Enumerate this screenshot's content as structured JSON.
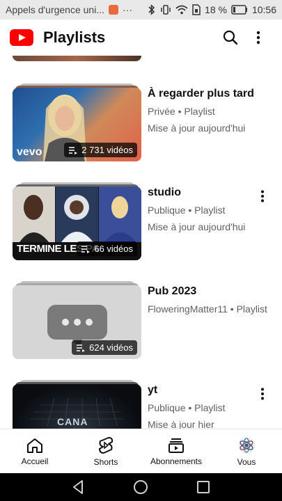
{
  "status_bar": {
    "notification": "Appels d'urgence uni...",
    "more": "···",
    "battery": "18 %",
    "time": "10:56"
  },
  "header": {
    "title": "Playlists",
    "search_icon": "search-icon",
    "more_icon": "more-vert-icon"
  },
  "playlists": [
    {
      "name": "À regarder plus tard",
      "line1": "Privée • Playlist",
      "line2": "Mise à jour aujourd'hui",
      "count": "2 731 vidéos",
      "watermark": "vevo"
    },
    {
      "name": "studio",
      "line1": "Publique • Playlist",
      "line2": "Mise à jour aujourd'hui",
      "count": "66 vidéos",
      "thumb_text": "TERMINE LES PA"
    },
    {
      "name": "Pub 2023",
      "line1": "FloweringMatter11 • Playlist",
      "line2": "",
      "count": "624 vidéos"
    },
    {
      "name": "yt",
      "line1": "Publique • Playlist",
      "line2": "Mise à jour hier",
      "thumb_text": "CANA"
    }
  ],
  "bottom_nav": {
    "home": "Accueil",
    "shorts": "Shorts",
    "subscriptions": "Abonnements",
    "you": "Vous"
  },
  "colors": {
    "brand_red": "#ff0000",
    "text_primary": "#0f0f0f",
    "text_secondary": "#606060"
  }
}
